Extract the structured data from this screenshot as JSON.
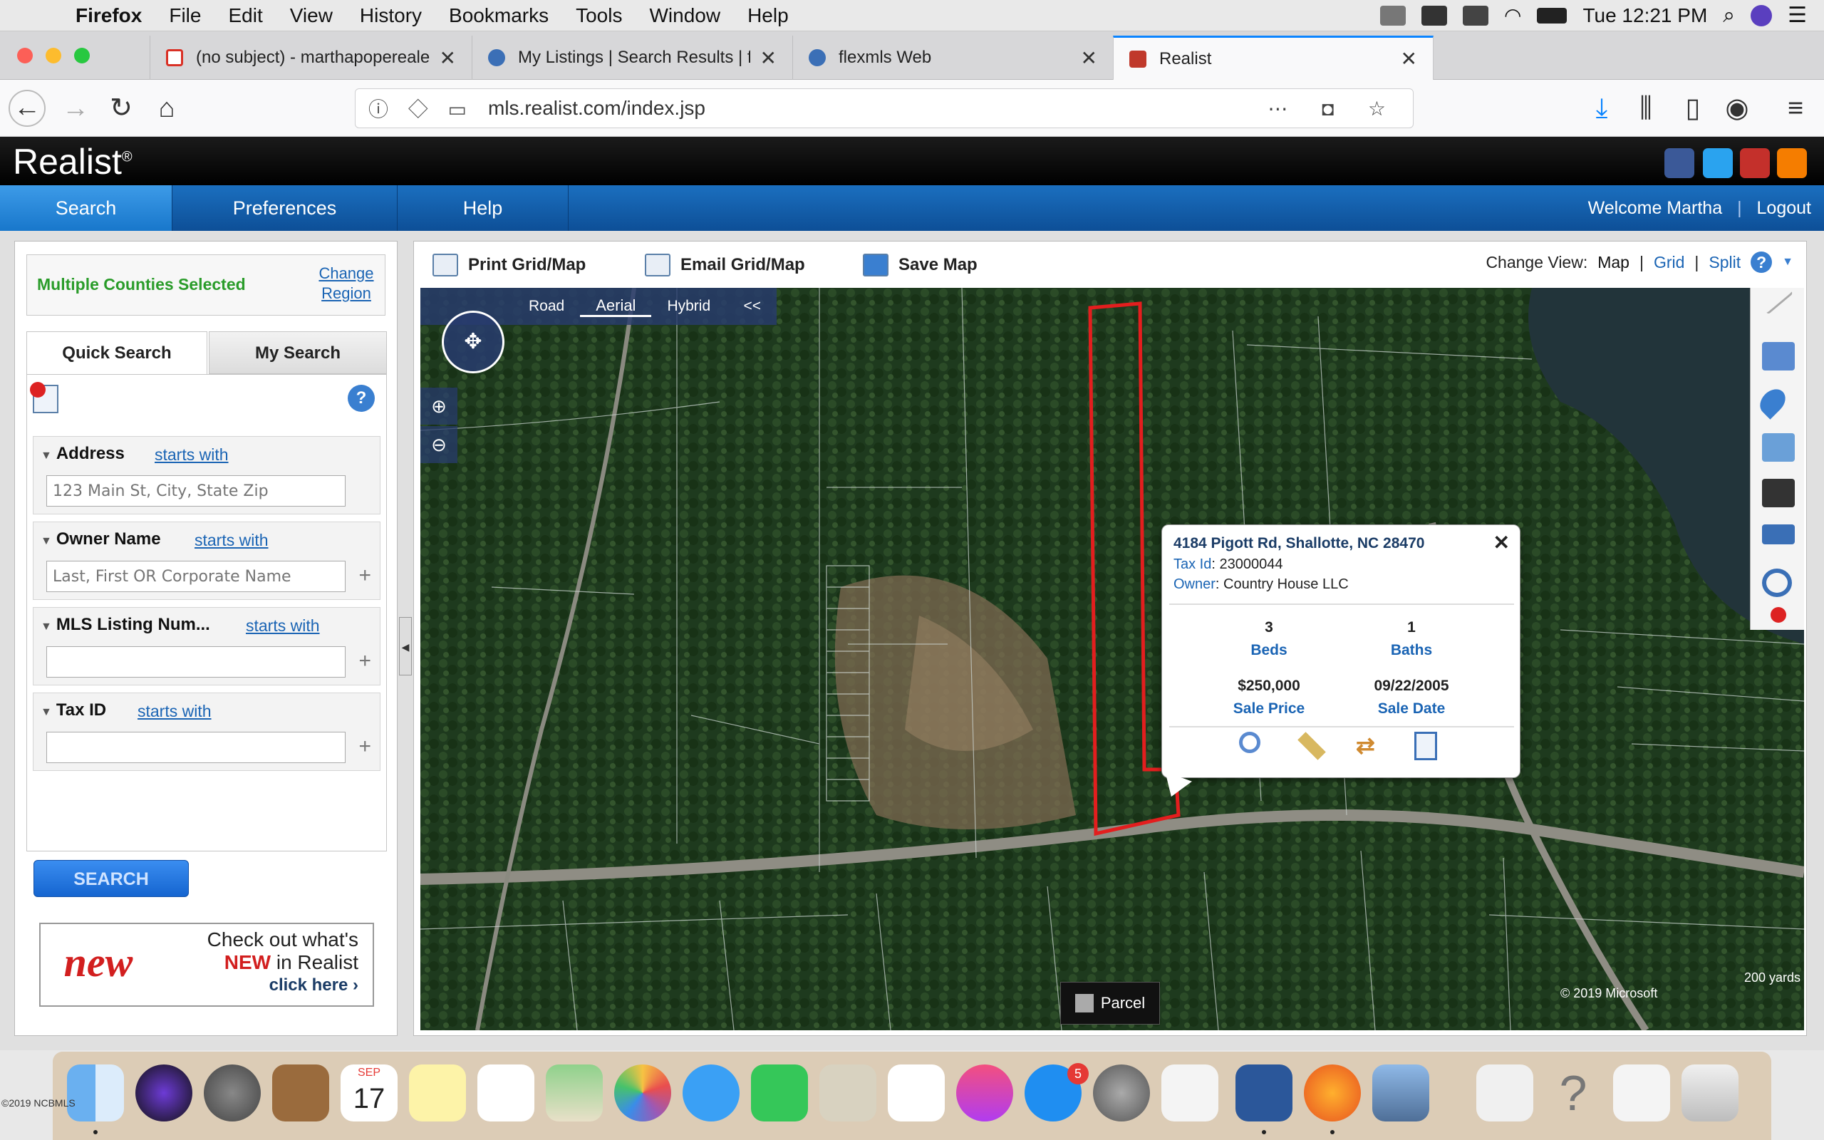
{
  "menubar": {
    "app": "Firefox",
    "items": [
      "File",
      "Edit",
      "View",
      "History",
      "Bookmarks",
      "Tools",
      "Window",
      "Help"
    ],
    "clock": "Tue 12:21 PM"
  },
  "browser": {
    "tabs": [
      {
        "label": "(no subject) - marthapopereale",
        "icon": "gmail-icon"
      },
      {
        "label": "My Listings | Search Results | fl",
        "icon": "flexmls-icon"
      },
      {
        "label": "flexmls Web",
        "icon": "flexmls-icon"
      },
      {
        "label": "Realist",
        "icon": "realist-icon"
      }
    ],
    "url": "mls.realist.com/index.jsp"
  },
  "realist": {
    "logo": "Realist",
    "nav": [
      "Search",
      "Preferences",
      "Help"
    ],
    "welcome": "Welcome Martha",
    "separator": "|",
    "logout": "Logout"
  },
  "left": {
    "region_title": "Multiple Counties Selected",
    "change_region": "Change Region",
    "tabs": [
      "Quick Search",
      "My Search"
    ],
    "sections": [
      {
        "title": "Address",
        "link": "starts with",
        "placeholder": "123 Main St, City, State Zip"
      },
      {
        "title": "Owner Name",
        "link": "starts with",
        "placeholder": "Last, First OR Corporate Name"
      },
      {
        "title": "MLS Listing Num...",
        "link": "starts with",
        "placeholder": ""
      },
      {
        "title": "Tax ID",
        "link": "starts with",
        "placeholder": ""
      }
    ],
    "search_button": "SEARCH",
    "promo": {
      "badge": "new",
      "line1": "Check out what's",
      "line2_red": "NEW",
      "line2_rest": " in Realist",
      "line3": "click here ›"
    }
  },
  "toolbar": {
    "print": "Print Grid/Map",
    "email": "Email Grid/Map",
    "save": "Save Map",
    "change_view": "Change View:",
    "views": [
      "Map",
      "Grid",
      "Split"
    ]
  },
  "map": {
    "types": [
      "Road",
      "Aerial",
      "Hybrid"
    ],
    "collapse": "<<",
    "parcel": "Parcel",
    "copyright": "© 2019 Microsoft",
    "scale": "200 yards"
  },
  "popup": {
    "address": "4184 Pigott Rd, Shallotte, NC 28470",
    "tax_label": "Tax Id",
    "tax_id": "23000044",
    "owner_label": "Owner",
    "owner": "Country House LLC",
    "beds": "3",
    "beds_label": "Beds",
    "baths": "1",
    "baths_label": "Baths",
    "sale_price": "$250,000",
    "sale_price_label": "Sale Price",
    "sale_date": "09/22/2005",
    "sale_date_label": "Sale Date"
  },
  "dock": {
    "calendar_month": "SEP",
    "calendar_day": "17",
    "appstore_badge": "5",
    "watermark": "©2019 NCBMLS"
  }
}
